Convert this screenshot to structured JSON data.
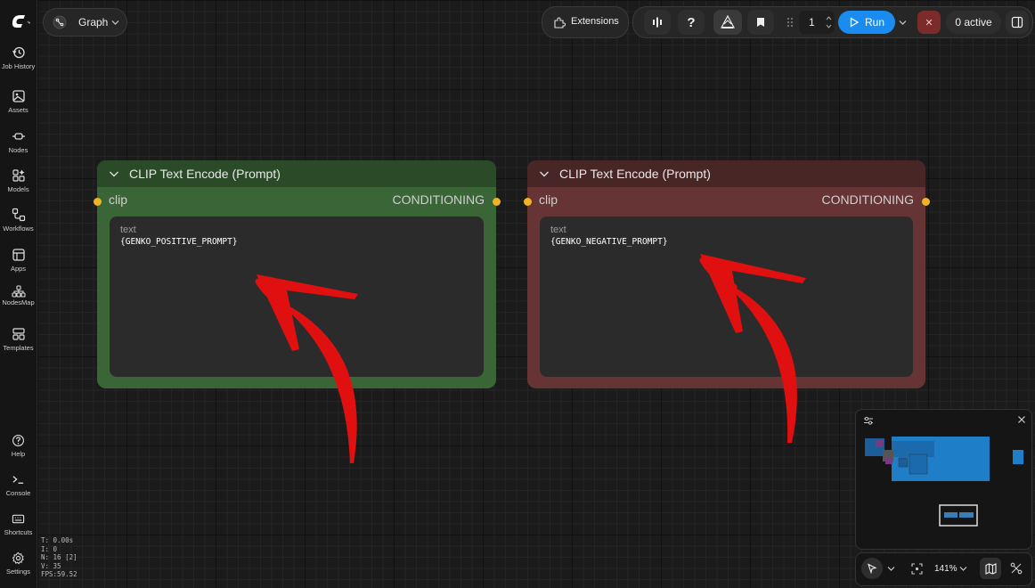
{
  "header": {
    "graph_label": "Graph"
  },
  "toolbar": {
    "extensions_label": "Extensions",
    "help_symbol": "?",
    "queue_count": "1",
    "run_label": "Run",
    "close_symbol": "✕",
    "active_label": "0 active"
  },
  "sidebar": {
    "items": [
      {
        "label": "Job History",
        "icon": "history-icon"
      },
      {
        "label": "Assets",
        "icon": "image-icon"
      },
      {
        "label": "Nodes",
        "icon": "nodes-icon"
      },
      {
        "label": "Models",
        "icon": "models-icon"
      },
      {
        "label": "Workflows",
        "icon": "workflow-icon"
      },
      {
        "label": "Apps",
        "icon": "apps-icon"
      },
      {
        "label": "NodesMap",
        "icon": "nodesmap-icon"
      },
      {
        "label": "Templates",
        "icon": "templates-icon"
      }
    ],
    "bottom_items": [
      {
        "label": "Help",
        "icon": "help-icon"
      },
      {
        "label": "Console",
        "icon": "console-icon"
      },
      {
        "label": "Shortcuts",
        "icon": "keyboard-icon"
      },
      {
        "label": "Settings",
        "icon": "gear-icon"
      }
    ]
  },
  "stats": [
    "T: 0.00s",
    "I: 0",
    "N: 16 [2]",
    "V: 35",
    "FPS:59.52"
  ],
  "nodes": [
    {
      "title": "CLIP Text Encode (Prompt)",
      "input": "clip",
      "output": "CONDITIONING",
      "field_label": "text",
      "field_value": "{GENKO_POSITIVE_PROMPT}",
      "color": "#3d6b3a",
      "header_color": "#2d4a2a"
    },
    {
      "title": "CLIP Text Encode (Prompt)",
      "input": "clip",
      "output": "CONDITIONING",
      "field_label": "text",
      "field_value": "{GENKO_NEGATIVE_PROMPT}",
      "color": "#693535",
      "header_color": "#492726"
    }
  ],
  "canvas_controls": {
    "zoom": "141%"
  }
}
